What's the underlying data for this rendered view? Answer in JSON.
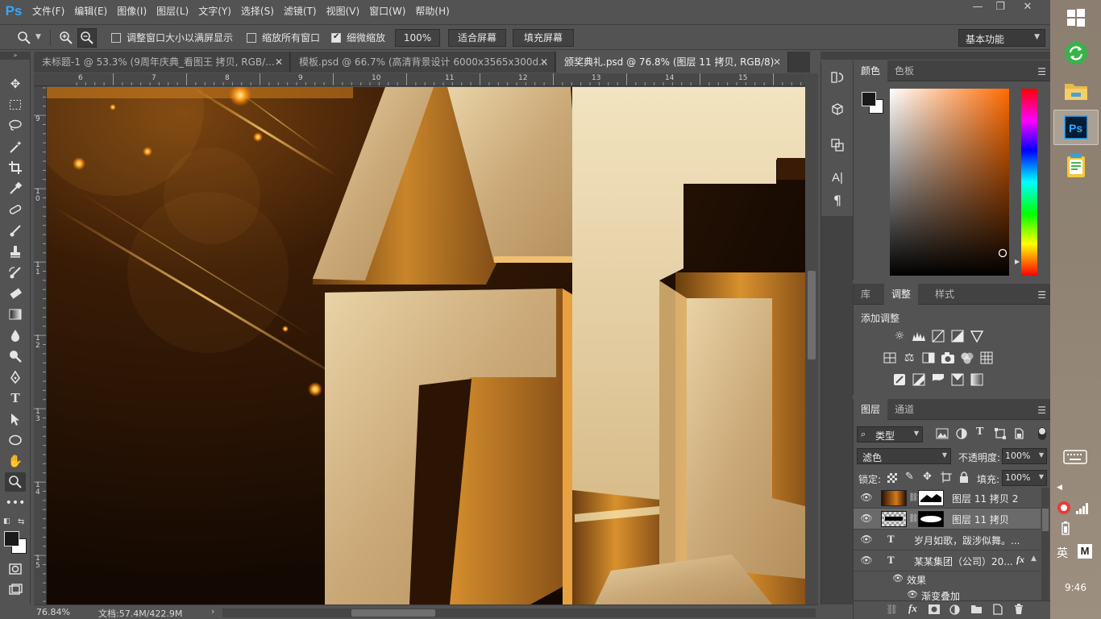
{
  "app": {
    "logo": "Ps"
  },
  "menu": [
    "文件(F)",
    "编辑(E)",
    "图像(I)",
    "图层(L)",
    "文字(Y)",
    "选择(S)",
    "滤镜(T)",
    "视图(V)",
    "窗口(W)",
    "帮助(H)"
  ],
  "window_controls": {
    "minimize": "—",
    "restore": "❐",
    "close": "✕"
  },
  "options": {
    "resize_windows_label": "调整窗口大小以满屏显示",
    "zoom_all_label": "缩放所有窗口",
    "scrubby_zoom_label": "细微缩放",
    "zoom_value": "100%",
    "fit_screen_label": "适合屏幕",
    "fill_screen_label": "填充屏幕",
    "workspace": "基本功能",
    "resize_windows_checked": false,
    "zoom_all_checked": false,
    "scrubby_zoom_checked": true
  },
  "tabs": [
    {
      "label": "未标题-1 @ 53.3% (9周年庆典_看图王 拷贝, RGB/...",
      "close": "✕"
    },
    {
      "label": "模板.psd @ 66.7% (高清背景设计 6000x3565x300d...",
      "close": "✕"
    },
    {
      "label": "颁奖典礼.psd @ 76.8% (图层 11 拷贝, RGB/8)",
      "close": "✕",
      "active": true
    }
  ],
  "ruler": {
    "top_ticks": [
      "6",
      "7",
      "8",
      "9",
      "10",
      "11",
      "12",
      "13",
      "14",
      "15"
    ],
    "left_ticks": [
      "9",
      "1 0",
      "1 1",
      "1 2",
      "1 3",
      "1 4",
      "1 5"
    ]
  },
  "tools": [
    "move-icon",
    "marquee-icon",
    "lasso-icon",
    "magic-wand-icon",
    "crop-icon",
    "eyedropper-icon",
    "healing-icon",
    "brush-icon",
    "stamp-icon",
    "history-brush-icon",
    "eraser-icon",
    "gradient-icon",
    "blur-icon",
    "dodge-icon",
    "pen-icon",
    "type-icon",
    "path-select-icon",
    "ellipse-icon",
    "hand-icon",
    "zoom-icon",
    "more-icon"
  ],
  "status": {
    "zoom": "76.84%",
    "doc": "文档:57.4M/422.9M"
  },
  "color_panel": {
    "tabs": [
      "颜色",
      "色板"
    ],
    "fg": "#1a1a1a",
    "bg": "#ffffff",
    "hue": "#ff6a00"
  },
  "adjust_panel": {
    "tabs": [
      "库",
      "调整",
      "样式"
    ],
    "title": "添加调整"
  },
  "layers_panel": {
    "tabs": [
      "图层",
      "通道"
    ],
    "filter_kind": "类型",
    "blend_mode": "滤色",
    "opacity_label": "不透明度:",
    "opacity_value": "100%",
    "lock_label": "锁定:",
    "fill_label": "填充:",
    "fill_value": "100%",
    "layers": [
      {
        "name": "图层 11 拷贝 2",
        "type": "image"
      },
      {
        "name": "图层 11 拷贝",
        "type": "image",
        "selected": true
      },
      {
        "name": "岁月如歌，跋涉似舞。...",
        "type": "text"
      },
      {
        "name": "某某集团（公司）20...",
        "type": "text",
        "fx": "fx"
      }
    ],
    "effects_label": "效果",
    "effect_item": "渐变叠加"
  },
  "taskbar": {
    "ime": "英",
    "ime_mode": "M",
    "time": "9:46"
  }
}
